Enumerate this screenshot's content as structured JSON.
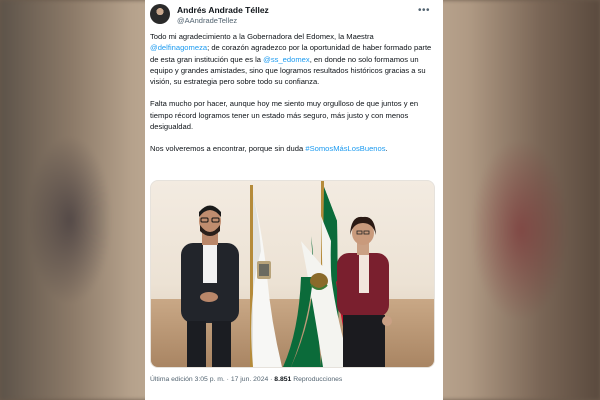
{
  "tweet": {
    "author_name": "Andrés Andrade Téllez",
    "author_handle": "@AAndradeTellez",
    "paragraph1": {
      "t1": "Todo mi agradecimiento a la Gobernadora del Edomex,  la Maestra ",
      "link1": "@delfinagomeza",
      "t2": "; de corazón agradezco por la oportunidad de haber formado parte de esta gran institución que es la ",
      "link2": "@ss_edomex",
      "t3": ", en donde no solo formamos un equipo y grandes amistades, sino que logramos resultados históricos gracias a su visión, su estrategia pero sobre todo su confianza."
    },
    "paragraph2": "Falta mucho por hacer, aunque hoy me siento muy orgulloso de que juntos y en tiempo récord logramos tener un estado más seguro, más justo y con menos desigualdad.",
    "paragraph3": {
      "t1": "Nos volveremos a encontrar, porque sin duda ",
      "hashtag": "#SomosMásLosBuenos",
      "t2": "."
    },
    "footer": {
      "edited": "Última edición 3:05 p. m. · 17 jun. 2024 · ",
      "views_count": "8.851",
      "views_label": " Reproducciones"
    }
  },
  "colors": {
    "link": "#1d9bf0",
    "text": "#0f1419",
    "secondary": "#536471",
    "flag_green": "#0b6b3a",
    "flag_red": "#c8102e",
    "jacket_red": "#7a1f2e"
  }
}
